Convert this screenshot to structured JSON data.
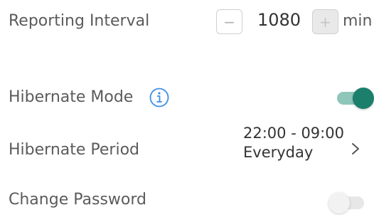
{
  "rows": {
    "reporting_interval": {
      "label": "Reporting Interval",
      "minus": "−",
      "plus": "+",
      "value": "1080",
      "unit": "min"
    },
    "hibernate_mode": {
      "label": "Hibernate Mode",
      "enabled": true,
      "info_icon": "info-icon"
    },
    "hibernate_period": {
      "label": "Hibernate Period",
      "time": "22:00 - 09:00",
      "days": "Everyday",
      "chevron_icon": "chevron-right-icon"
    },
    "change_password": {
      "label": "Change Password",
      "enabled": false
    }
  },
  "colors": {
    "accent": "#1b7f6b",
    "accent_track": "#8fc6ba",
    "label_text": "#5b5b5b",
    "value_text": "#333333",
    "info_blue": "#3a8ee6"
  }
}
